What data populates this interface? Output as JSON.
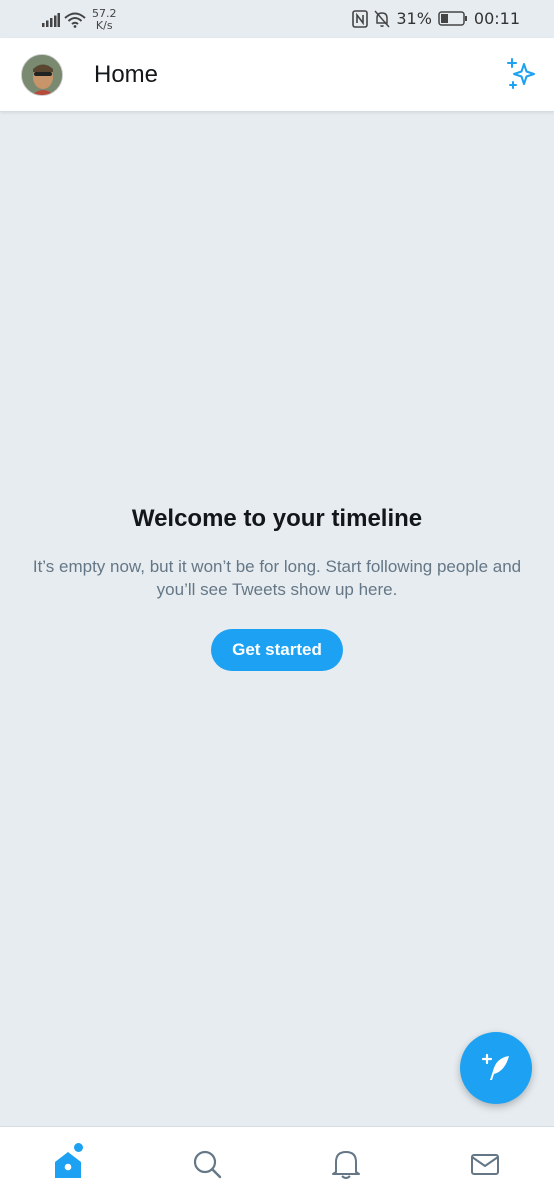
{
  "status_bar": {
    "net_speed_value": "57.2",
    "net_speed_unit": "K/s",
    "battery_percent": "31%",
    "time": "00:11",
    "icons": [
      "signal-icon",
      "wifi-icon",
      "nfc-icon",
      "mute-icon",
      "battery-icon"
    ]
  },
  "header": {
    "title": "Home",
    "avatar_icon": "avatar",
    "top_tweets_icon": "sparkle-icon"
  },
  "timeline": {
    "title": "Welcome to your timeline",
    "description": "It’s empty now, but it won’t be for long. Start following people and you’ll see Tweets show up here.",
    "button_label": "Get started"
  },
  "fab": {
    "icon": "compose-tweet-icon"
  },
  "bottom_nav": {
    "items": [
      {
        "icon": "home-icon",
        "active": true
      },
      {
        "icon": "search-icon",
        "active": false
      },
      {
        "icon": "bell-icon",
        "active": false
      },
      {
        "icon": "mail-icon",
        "active": false
      }
    ]
  },
  "colors": {
    "accent": "#1da1f2",
    "background": "#e6ecf0",
    "text_primary": "#14171a",
    "text_secondary": "#657786"
  }
}
